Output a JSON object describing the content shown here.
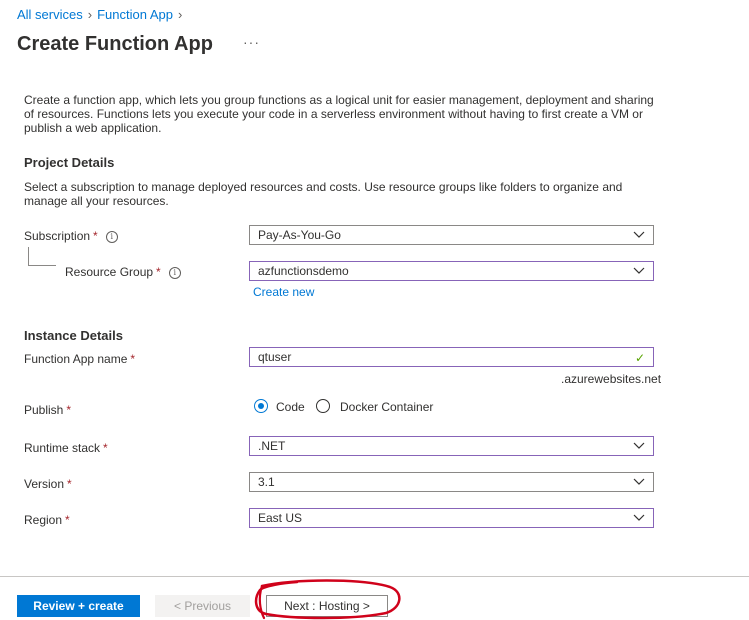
{
  "breadcrumb": {
    "items": [
      "All services",
      "Function App"
    ]
  },
  "page": {
    "title": "Create Function App",
    "more_label": "···",
    "intro": "Create a function app, which lets you group functions as a logical unit for easier management, deployment and sharing of resources. Functions lets you execute your code in a serverless environment without having to first create a VM or publish a web application."
  },
  "project": {
    "title": "Project Details",
    "description": "Select a subscription to manage deployed resources and costs. Use resource groups like folders to organize and manage all your resources.",
    "subscription_label": "Subscription",
    "subscription_value": "Pay-As-You-Go",
    "resource_group_label": "Resource Group",
    "resource_group_value": "azfunctionsdemo",
    "create_new": "Create new"
  },
  "instance": {
    "title": "Instance Details",
    "name_label": "Function App name",
    "name_value": "qtuser",
    "name_suffix": ".azurewebsites.net",
    "publish_label": "Publish",
    "publish_options": [
      "Code",
      "Docker Container"
    ],
    "publish_selected": "Code",
    "runtime_label": "Runtime stack",
    "runtime_value": ".NET",
    "version_label": "Version",
    "version_value": "3.1",
    "region_label": "Region",
    "region_value": "East US"
  },
  "footer": {
    "review_create": "Review + create",
    "previous": "< Previous",
    "next": "Next : Hosting >"
  },
  "colors": {
    "accent": "#0078d4",
    "required": "#a4262c",
    "valid_check": "#57a300",
    "focus_border": "#8764b8",
    "annotation": "#d0021b"
  }
}
